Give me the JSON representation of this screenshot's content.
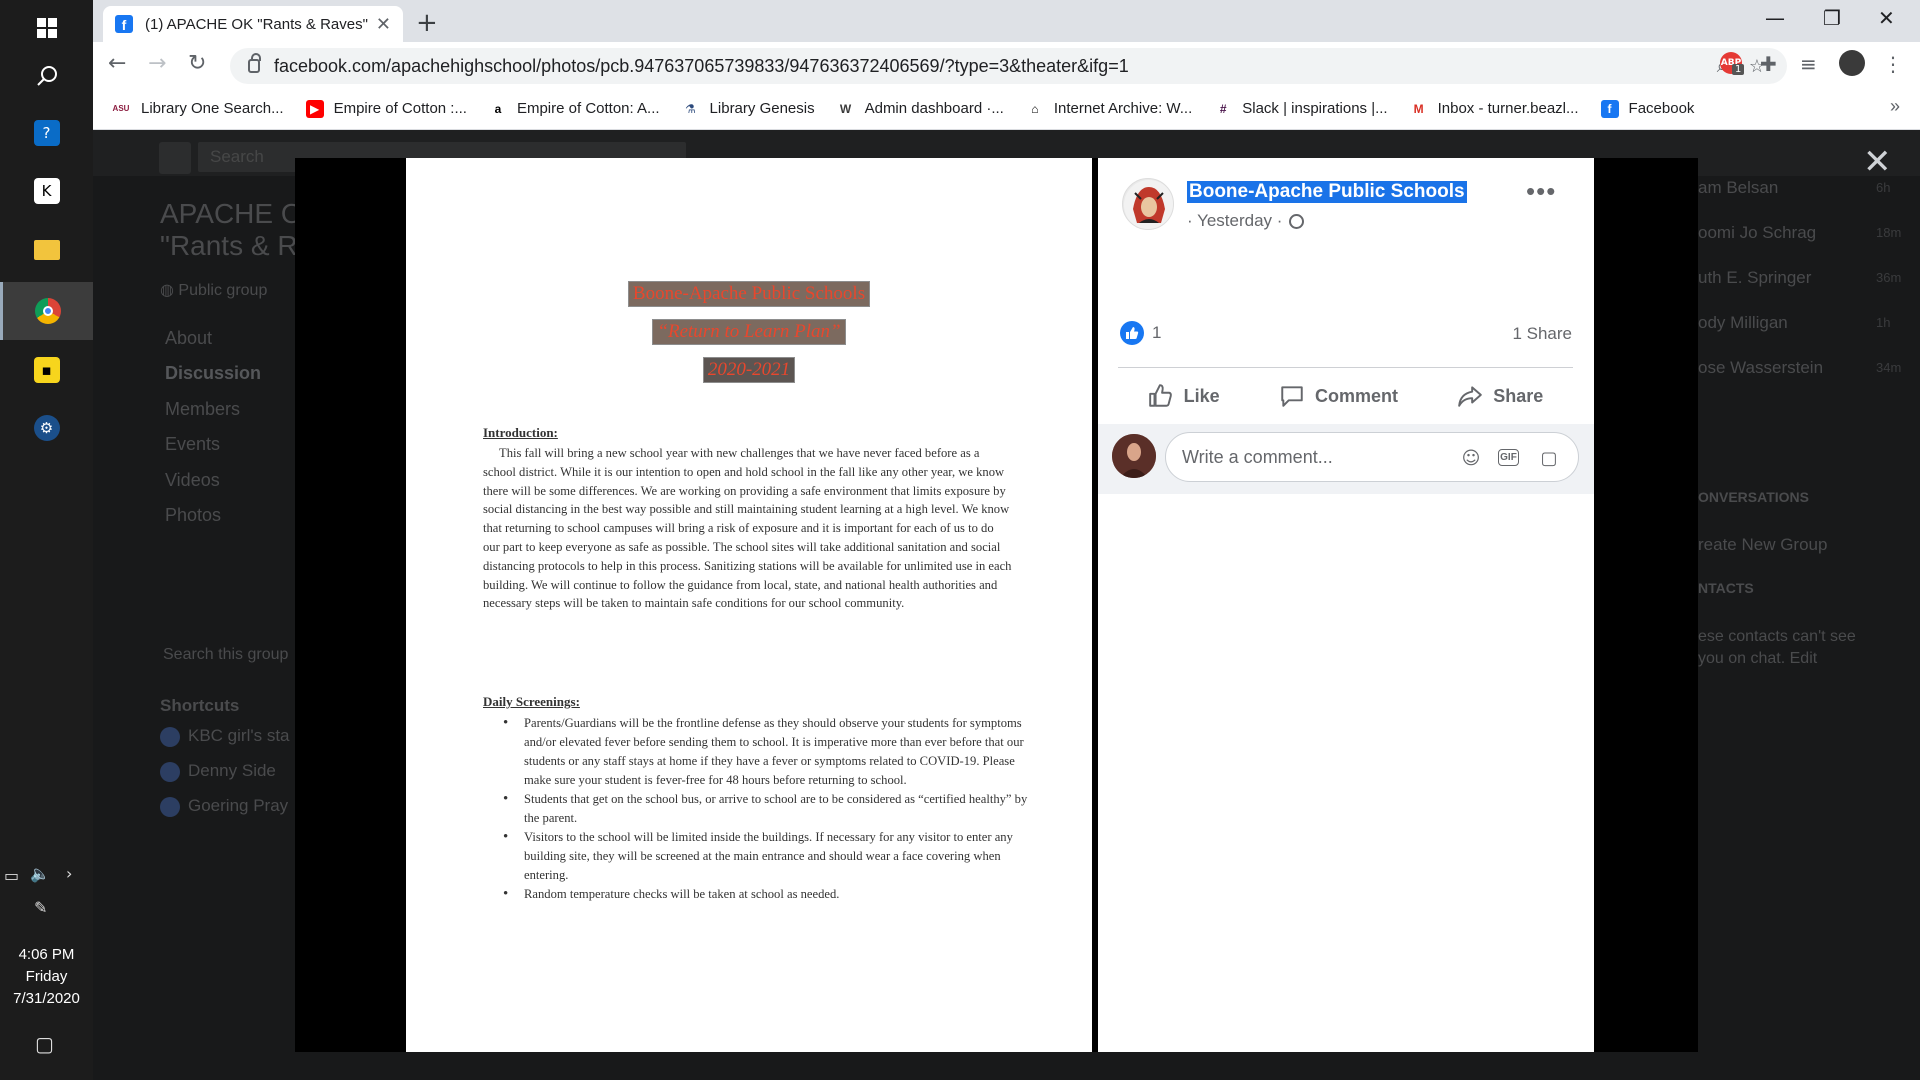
{
  "taskbar": {
    "clock_time": "4:06 PM",
    "clock_day": "Friday",
    "clock_date": "7/31/2020"
  },
  "browser": {
    "tab_title": "(1) APACHE OK \"Rants & Raves\"",
    "url": "facebook.com/apachehighschool/photos/pcb.947637065739833/947636372406569/?type=3&theater&ifg=1",
    "extension_badge": "1",
    "bookmarks": [
      {
        "label": "Library One Search...",
        "icon": "asu-icon",
        "color": "#8c1d40"
      },
      {
        "label": "Empire of Cotton :...",
        "icon": "youtube-icon",
        "color": "#ff0000"
      },
      {
        "label": "Empire of Cotton: A...",
        "icon": "amazon-icon",
        "color": "#000000"
      },
      {
        "label": "Library Genesis",
        "icon": "libgen-icon",
        "color": "#2c4a7c"
      },
      {
        "label": "Admin dashboard ·...",
        "icon": "wordpress-icon",
        "color": "#3c3c3c"
      },
      {
        "label": "Internet Archive: W...",
        "icon": "archive-icon",
        "color": "#000000"
      },
      {
        "label": "Slack | inspirations |...",
        "icon": "slack-icon",
        "color": "#4a154b"
      },
      {
        "label": "Inbox - turner.beazl...",
        "icon": "gmail-icon",
        "color": "#d93025"
      },
      {
        "label": "Facebook",
        "icon": "facebook-icon",
        "color": "#1877f2"
      }
    ]
  },
  "background_page": {
    "search_placeholder": "Search",
    "group_title_1": "APACHE O",
    "group_title_2": "\"Rants & R",
    "group_type": "Public group",
    "nav": [
      "About",
      "Discussion",
      "Members",
      "Events",
      "Videos",
      "Photos"
    ],
    "search_group": "Search this group",
    "shortcuts_heading": "Shortcuts",
    "shortcuts": [
      "KBC girl's sta",
      "Denny Side",
      "Goering Pray"
    ],
    "contacts": [
      {
        "name": "am Belsan",
        "time": "6h"
      },
      {
        "name": "oomi Jo Schrag",
        "time": "18m"
      },
      {
        "name": "uth E. Springer",
        "time": "36m"
      },
      {
        "name": "ody Milligan",
        "time": "1h"
      },
      {
        "name": "ose Wasserstein",
        "time": "34m"
      }
    ],
    "conversations_heading": "ONVERSATIONS",
    "create_group": "reate New Group",
    "contacts_heading": "NTACTS",
    "contacts_note_1": "ese contacts can't see",
    "contacts_note_2": "you on chat. Edit"
  },
  "document": {
    "title": "Boone-Apache Public Schools",
    "subtitle": "“Return to Learn Plan”",
    "year": "2020-2021",
    "intro_heading": "Introduction:",
    "intro_text": "This fall will bring a new school year with new challenges that we have never faced before as a school district.  While it is our intention to open and hold school in the fall like any other year, we know there will be some differences. We are working on providing a safe environment that limits exposure by social distancing in the best way possible and still maintaining student learning at a high level. We know that returning to school campuses will bring a risk of exposure and it is important for each of us to do our part to keep everyone as safe as possible. The school sites will take additional sanitation and social distancing protocols to help in this process. Sanitizing stations will be available for unlimited use in each building. We will continue to follow the guidance from local, state, and national health authorities and necessary steps will be taken to maintain safe conditions for our school community.",
    "screening_heading": "Daily Screenings:",
    "screening_bullets": [
      "Parents/Guardians will be the frontline defense as they should observe your students for symptoms and/or elevated fever before sending them to school. It is imperative more than ever before that our students or any staff stays at home if they have a fever or symptoms related to COVID-19. Please make sure your student is fever-free for 48 hours before returning to school.",
      "Students that get on the school bus, or arrive to school are to be considered as “certified healthy” by the parent.",
      "Visitors to the school will be limited inside the buildings. If necessary for any visitor to enter any building site, they will be screened at the main entrance and should wear a face covering when entering.",
      "Random temperature checks will be taken at school as needed."
    ]
  },
  "post": {
    "page_name": "Boone-Apache Public Schools",
    "time": "· Yesterday ·",
    "like_count": "1",
    "share_count": "1 Share",
    "actions": {
      "like": "Like",
      "comment": "Comment",
      "share": "Share"
    },
    "comment_placeholder": "Write a comment...",
    "gif_label": "GIF"
  }
}
